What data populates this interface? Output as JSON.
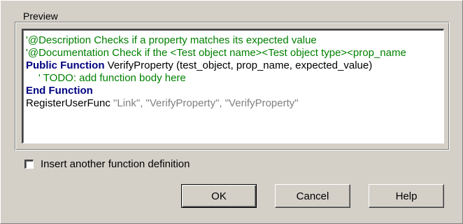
{
  "preview": {
    "label": "Preview",
    "code": {
      "line1": "'@Description Checks if a property matches its expected value",
      "line2": "'@Documentation Check if the <Test object name><Test object type><prop_name",
      "line3_keyword": "Public Function",
      "line3_rest": " VerifyProperty (test_object, prop_name, expected_value)",
      "line4": "' TODO: add function body here",
      "line5_keyword": "End Function",
      "line6_func": "RegisterUserFunc ",
      "line6_args": "\"Link\", \"VerifyProperty\", \"VerifyProperty\""
    }
  },
  "options": {
    "insert_another_label": "Insert another function definition",
    "insert_another_checked": false
  },
  "buttons": {
    "ok": "OK",
    "cancel": "Cancel",
    "help": "Help"
  },
  "colors": {
    "comment": "#008000",
    "keyword": "#000080",
    "dialog_bg": "#d4d0c8"
  }
}
